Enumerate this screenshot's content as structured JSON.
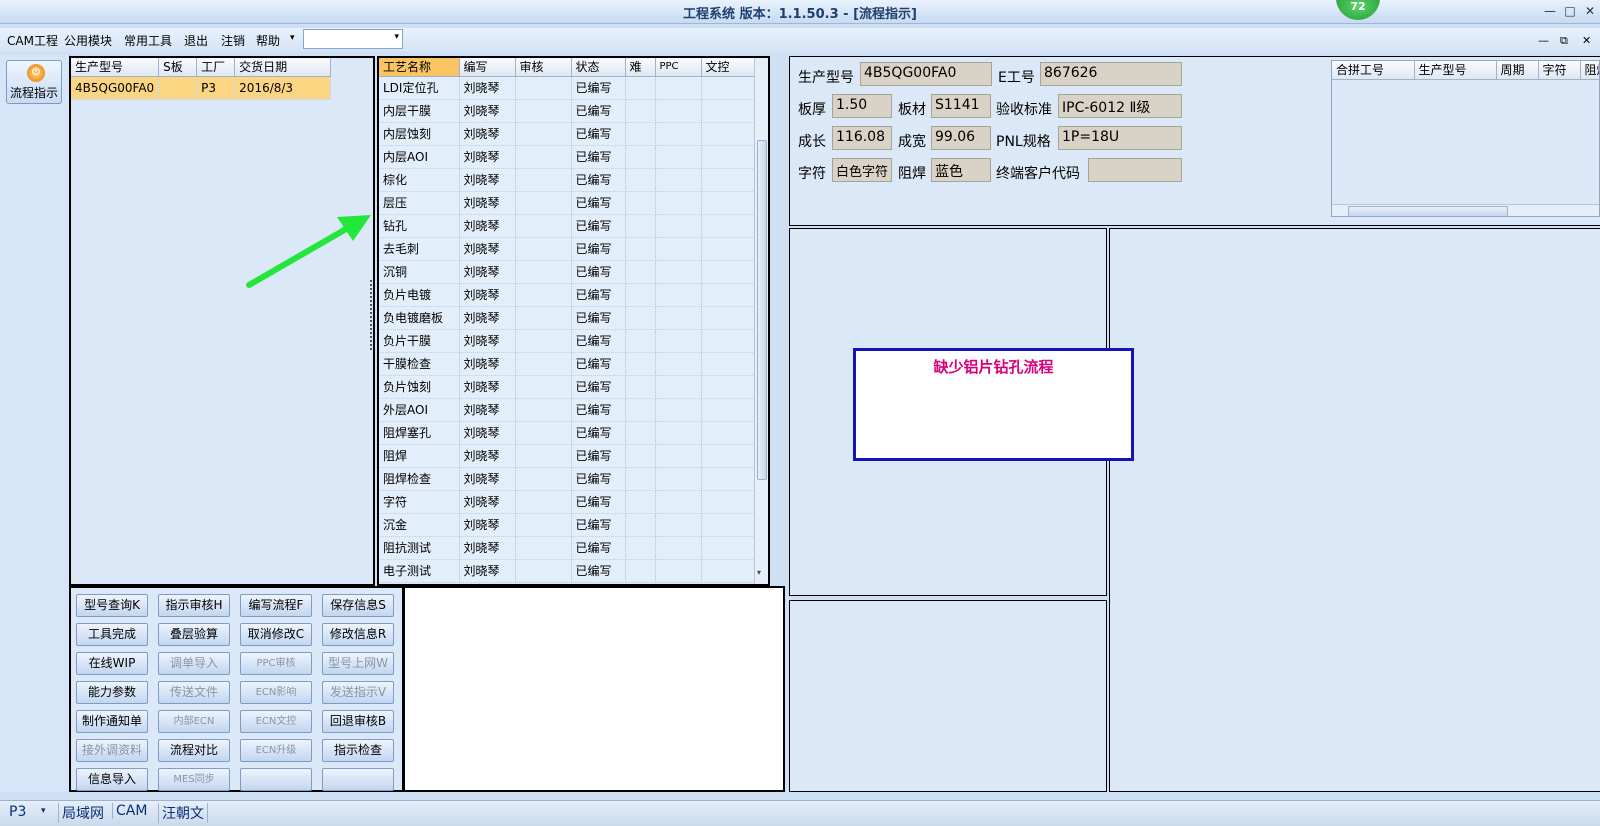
{
  "window": {
    "title": "工程系统  版本：1.1.50.3 - [流程指示]",
    "badge": "72",
    "controls": [
      "—",
      "□",
      "✕"
    ]
  },
  "menubar": {
    "items": [
      "CAM工程",
      "公用模块",
      "常用工具",
      "退出",
      "注销",
      "帮助"
    ],
    "dropdown_arrow": "▾",
    "mdi_controls": [
      "—",
      "⧉",
      "✕"
    ]
  },
  "sidebar": {
    "flow_button_icon": "⏻",
    "flow_button_label": "流程指示"
  },
  "model_grid": {
    "headers": [
      "生产型号",
      "S板",
      "工厂",
      "交货日期"
    ],
    "rows": [
      [
        "4B5QG00FA0",
        "",
        "P3",
        "2016/8/3"
      ]
    ]
  },
  "process_grid": {
    "headers": [
      "工艺名称",
      "编写",
      "审核",
      "状态",
      "难",
      "PPC",
      "文控"
    ],
    "rows": [
      [
        "LDI定位孔",
        "刘晓琴",
        "",
        "已编写"
      ],
      [
        "内层干膜",
        "刘晓琴",
        "",
        "已编写"
      ],
      [
        "内层蚀刻",
        "刘晓琴",
        "",
        "已编写"
      ],
      [
        "内层AOI",
        "刘晓琴",
        "",
        "已编写"
      ],
      [
        "棕化",
        "刘晓琴",
        "",
        "已编写"
      ],
      [
        "层压",
        "刘晓琴",
        "",
        "已编写"
      ],
      [
        "钻孔",
        "刘晓琴",
        "",
        "已编写"
      ],
      [
        "去毛刺",
        "刘晓琴",
        "",
        "已编写"
      ],
      [
        "沉铜",
        "刘晓琴",
        "",
        "已编写"
      ],
      [
        "负片电镀",
        "刘晓琴",
        "",
        "已编写"
      ],
      [
        "负电镀磨板",
        "刘晓琴",
        "",
        "已编写"
      ],
      [
        "负片干膜",
        "刘晓琴",
        "",
        "已编写"
      ],
      [
        "干膜检查",
        "刘晓琴",
        "",
        "已编写"
      ],
      [
        "负片蚀刻",
        "刘晓琴",
        "",
        "已编写"
      ],
      [
        "外层AOI",
        "刘晓琴",
        "",
        "已编写"
      ],
      [
        "阻焊塞孔",
        "刘晓琴",
        "",
        "已编写"
      ],
      [
        "阻焊",
        "刘晓琴",
        "",
        "已编写"
      ],
      [
        "阻焊检查",
        "刘晓琴",
        "",
        "已编写"
      ],
      [
        "字符",
        "刘晓琴",
        "",
        "已编写"
      ],
      [
        "沉金",
        "刘晓琴",
        "",
        "已编写"
      ],
      [
        "阻抗测试",
        "刘晓琴",
        "",
        "已编写"
      ],
      [
        "电子测试",
        "刘晓琴",
        "",
        "已编写"
      ]
    ]
  },
  "info": {
    "model_label": "生产型号",
    "model": "4B5QG00FA0",
    "eno_label": "E工号",
    "eno": "867626",
    "thickness_label": "板厚",
    "thickness": "1.50",
    "material_label": "板材",
    "material": "S1141",
    "standard_label": "验收标准",
    "standard": "IPC-6012 Ⅱ级",
    "length_label": "成长",
    "length": "116.08",
    "width_label": "成宽",
    "width": "99.06",
    "pnl_label": "PNL规格",
    "pnl": "1P=18U",
    "char_label": "字符",
    "char": "白色字符",
    "mask_label": "阻焊",
    "mask": "蓝色",
    "customer_label": "终端客户代码",
    "customer": ""
  },
  "merge_grid": {
    "headers": [
      "合拼工号",
      "生产型号",
      "周期",
      "字符",
      "阻焊"
    ]
  },
  "warning": {
    "text": "缺少铝片钻孔流程",
    "color": "#d6007a"
  },
  "buttons": [
    [
      "型号查询K",
      "指示审核H",
      "编写流程F",
      "保存信息S"
    ],
    [
      "工具完成",
      "叠层验算",
      "取消修改C",
      "修改信息R"
    ],
    [
      "在线WIP",
      "调单导入",
      "PPC审核",
      "型号上网W"
    ],
    [
      "能力参数",
      "传送文件",
      "ECN影响",
      "发送指示V"
    ],
    [
      "制作通知单",
      "内部ECN",
      "ECN文控",
      "回退审核B"
    ],
    [
      "接外调资料",
      "流程对比",
      "ECN升级",
      "指示检查"
    ],
    [
      "信息导入",
      "MES同步",
      "",
      ""
    ]
  ],
  "statusbar": {
    "factory": "P3",
    "items": [
      "局域网",
      "CAM",
      "汪朝文"
    ]
  }
}
